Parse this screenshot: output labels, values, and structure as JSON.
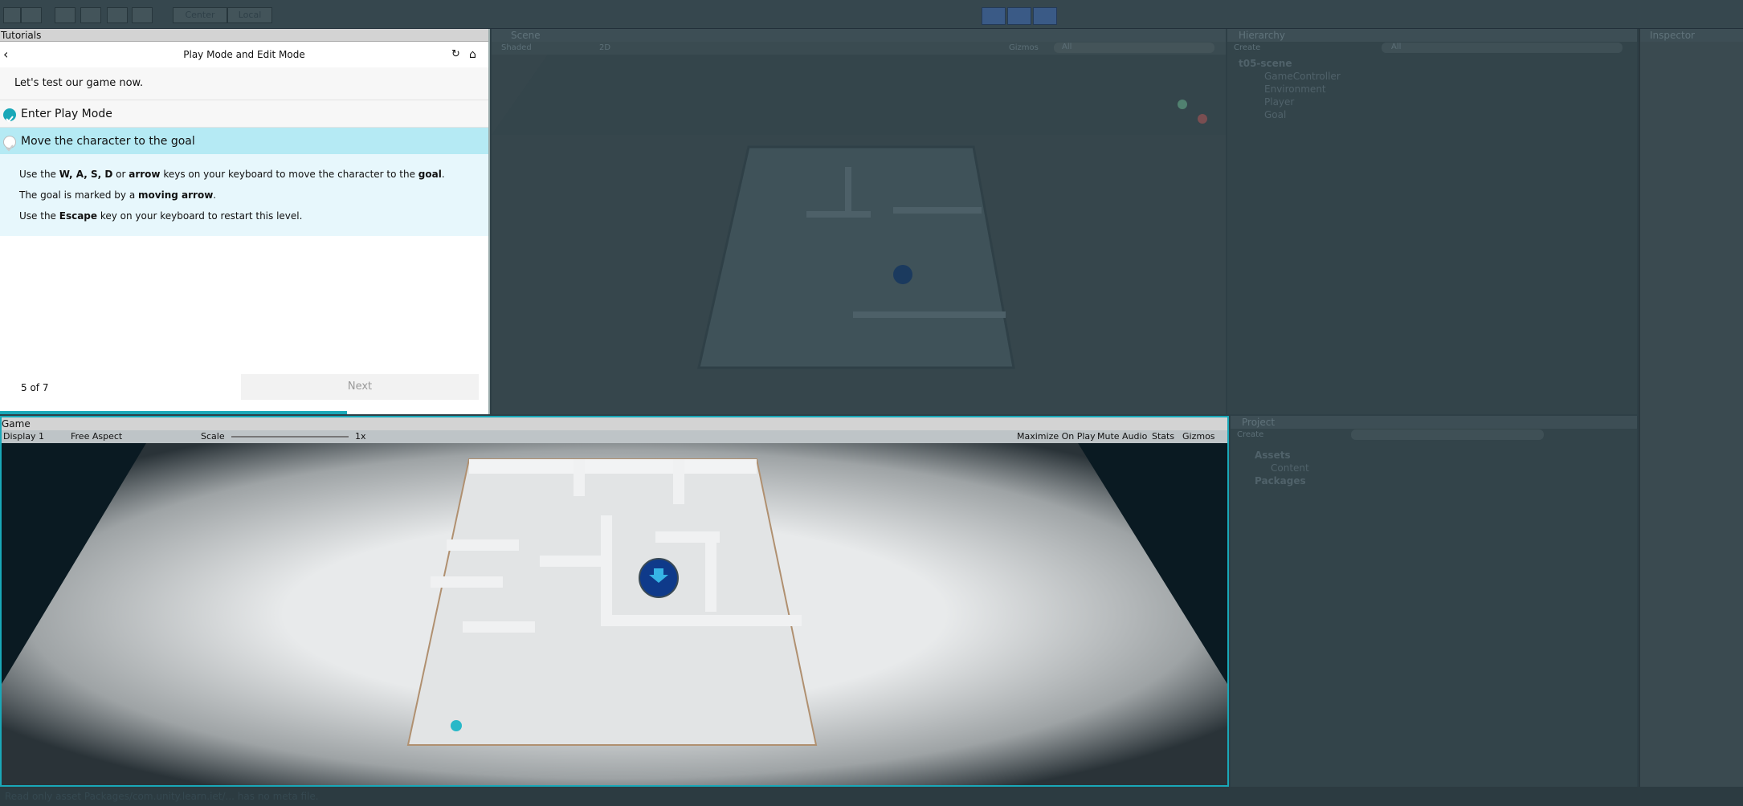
{
  "toolbar": {
    "pivot": "Center",
    "space": "Local"
  },
  "tutorial": {
    "tab": "Tutorials",
    "title": "Play Mode and Edit Mode",
    "intro": "Let's test our game now.",
    "steps": [
      {
        "label": "Enter Play Mode",
        "done": true
      },
      {
        "label": "Move the character to the goal",
        "done": false
      }
    ],
    "desc": {
      "l1a": "Use the ",
      "l1b": "W, A, S, D",
      "l1c": " or ",
      "l1d": "arrow",
      "l1e": " keys on your keyboard to move the character to the ",
      "l1f": "goal",
      "l1g": ".",
      "l2a": "The goal is marked by a ",
      "l2b": "moving arrow",
      "l2c": ".",
      "l3a": "Use the ",
      "l3b": "Escape",
      "l3c": " key on your keyboard to restart this level."
    },
    "progress": "5 of 7",
    "next": "Next"
  },
  "scene": {
    "tab": "Scene",
    "shading": "Shaded",
    "mode2d": "2D",
    "gizmos": "Gizmos",
    "search": "All"
  },
  "hierarchy": {
    "tab": "Hierarchy",
    "create": "Create",
    "search": "All",
    "root": "t05-scene",
    "items": [
      "GameController",
      "Environment",
      "Player",
      "Goal"
    ]
  },
  "inspector": {
    "tab": "Inspector"
  },
  "game": {
    "tab": "Game",
    "display": "Display 1",
    "aspect": "Free Aspect",
    "scale_label": "Scale",
    "scale_value": "1x",
    "maximize": "Maximize On Play",
    "mute": "Mute Audio",
    "stats": "Stats",
    "gizmos": "Gizmos"
  },
  "project": {
    "tab": "Project",
    "create": "Create",
    "items": [
      "Assets",
      "Content",
      "Packages"
    ]
  },
  "status": {
    "text": "Read only asset Packages/com.unity.learn.iet/... has no meta file."
  },
  "colors": {
    "accent": "#19a8b8",
    "highlight": "#b5eaf4"
  }
}
